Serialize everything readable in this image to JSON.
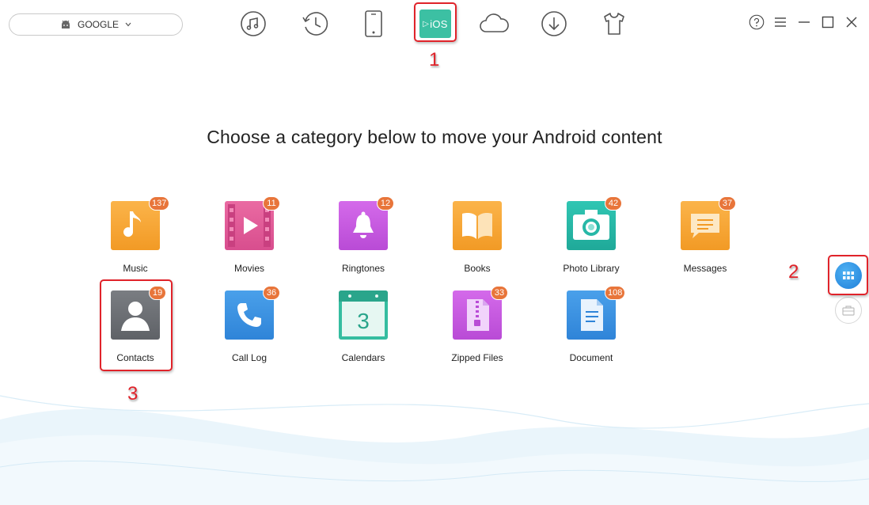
{
  "device": {
    "name": "GOOGLE",
    "icon": "android-icon"
  },
  "toolbar": [
    {
      "name": "music-icon"
    },
    {
      "name": "history-icon"
    },
    {
      "name": "phone-icon"
    },
    {
      "name": "ios-icon",
      "label": "iOS",
      "active": true
    },
    {
      "name": "cloud-icon"
    },
    {
      "name": "download-icon"
    },
    {
      "name": "tshirt-icon"
    }
  ],
  "window_controls": [
    "help-icon",
    "menu-icon",
    "minimize-icon",
    "maximize-icon",
    "close-icon"
  ],
  "heading": "Choose a category below to move your Android content",
  "categories": [
    {
      "label": "Music",
      "count": "137",
      "color": "#f7a232",
      "icon": "music-note-icon"
    },
    {
      "label": "Movies",
      "count": "11",
      "color": "#e45f9a",
      "icon": "film-icon"
    },
    {
      "label": "Ringtones",
      "count": "12",
      "color": "#c55be0",
      "icon": "bell-icon"
    },
    {
      "label": "Books",
      "count": "",
      "color": "#f7a232",
      "icon": "book-icon"
    },
    {
      "label": "Photo Library",
      "count": "42",
      "color": "#27b8a7",
      "icon": "camera-icon"
    },
    {
      "label": "Messages",
      "count": "37",
      "color": "#f7a232",
      "icon": "message-icon"
    },
    {
      "label": "Contacts",
      "count": "19",
      "color": "#6b6e73",
      "icon": "person-icon"
    },
    {
      "label": "Call Log",
      "count": "36",
      "color": "#3a8fe0",
      "icon": "phone-handset-icon"
    },
    {
      "label": "Calendars",
      "count": "",
      "color": "#35bda0",
      "icon": "calendar-icon",
      "day": "3"
    },
    {
      "label": "Zipped Files",
      "count": "33",
      "color": "#c55be0",
      "icon": "zip-icon"
    },
    {
      "label": "Document",
      "count": "108",
      "color": "#3a8fe0",
      "icon": "document-icon"
    }
  ],
  "side_buttons": [
    {
      "name": "category-view-icon",
      "active": true,
      "color": "#2f8fe3"
    },
    {
      "name": "toolbox-icon",
      "active": false
    }
  ],
  "callouts": [
    "1",
    "2",
    "3"
  ]
}
